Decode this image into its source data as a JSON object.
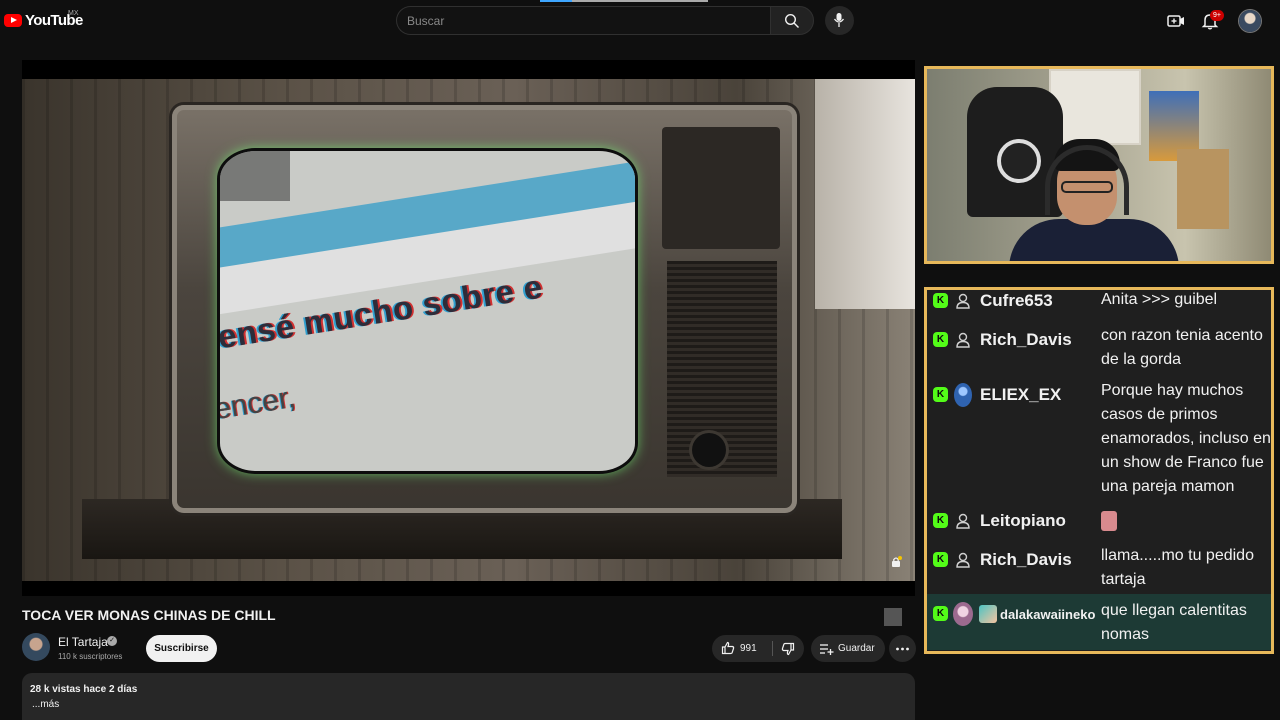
{
  "header": {
    "logo_text": "YouTube",
    "country": "MX",
    "search_placeholder": "Buscar",
    "notification_count": "9+",
    "icons": [
      "search-icon",
      "mic-icon",
      "create-icon",
      "bell-icon"
    ]
  },
  "video": {
    "screen_text_main": "ensé mucho sobre e",
    "screen_text_second": "encer,"
  },
  "meta": {
    "title": "TOCA VER MONAS CHINAS DE CHILL",
    "channel_name": "El Tartaja",
    "subscribers": "110 k suscriptores",
    "subscribe_label": "Suscribirse",
    "likes": "991",
    "save_label": "Guardar",
    "views_date": "28 k vistas  hace 2 días",
    "more_label": "...más"
  },
  "chat": {
    "messages": [
      {
        "user": "Cufre653",
        "text": "Anita >>> guibel"
      },
      {
        "user": "Rich_Davis",
        "text": "con razon tenia acento de la gorda"
      },
      {
        "user": "ELIEX_EX",
        "text": "Porque hay muchos casos de primos enamorados, incluso en un show de Franco fue una pareja mamon"
      },
      {
        "user": "Leitopiano",
        "text": ""
      },
      {
        "user": "Rich_Davis",
        "text": "llama.....mo tu pedido tartaja"
      },
      {
        "user": "dalakawaiineko",
        "text": "que llegan calentitas nomas"
      }
    ],
    "badge_letter": "K"
  },
  "colors": {
    "accent_red": "#ff0000",
    "overlay_border": "#e7b85a",
    "kick_green": "#53fc18"
  }
}
